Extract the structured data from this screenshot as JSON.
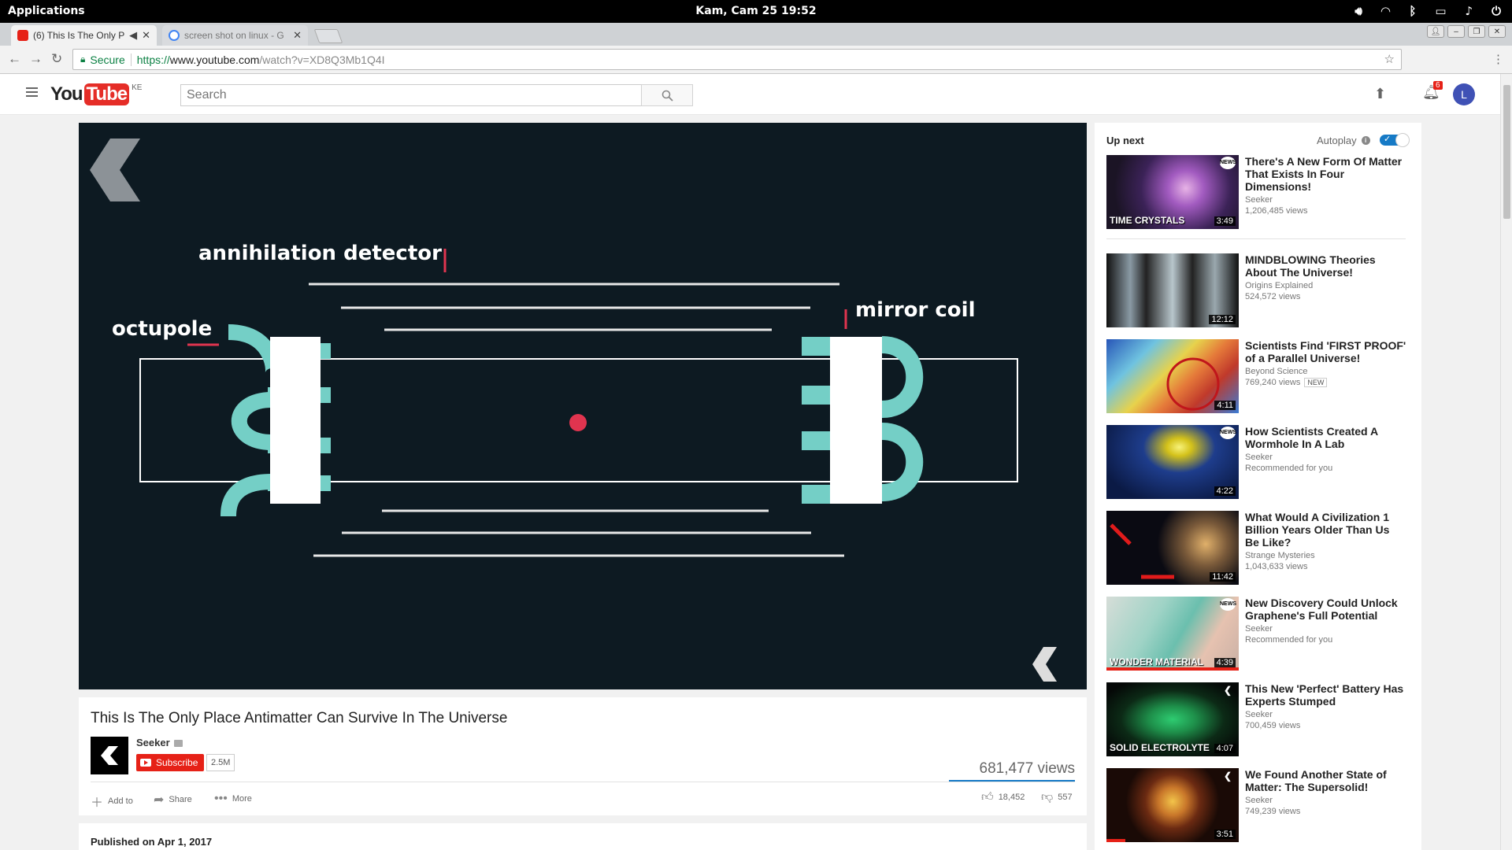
{
  "os_bar": {
    "applications": "Applications",
    "clock": "Kam, Cam 25   19:52"
  },
  "tabs": [
    {
      "label": "(6) This Is The Only P",
      "active": true
    },
    {
      "label": "screen shot on linux - G",
      "active": false
    }
  ],
  "address": {
    "secure": "Secure",
    "proto": "https://",
    "host": "www.youtube.com",
    "path": "/watch?v=XD8Q3Mb1Q4I"
  },
  "header": {
    "logo_you": "You",
    "logo_tube": "Tube",
    "country": "KE",
    "search_placeholder": "Search",
    "notifications": "6",
    "avatar_letter": "L"
  },
  "player": {
    "label_detector": "annihilation detector",
    "label_octupole": "octupole",
    "label_mirror": "mirror coil"
  },
  "video": {
    "title": "This Is The Only Place Antimatter Can Survive In The Universe",
    "channel": "Seeker",
    "subscribe": "Subscribe",
    "subscribers": "2.5M",
    "views": "681,477 views",
    "add_to": "Add to",
    "share": "Share",
    "more": "More",
    "likes": "18,452",
    "dislikes": "557",
    "published": "Published on Apr 1, 2017"
  },
  "sidebar": {
    "up_next": "Up next",
    "autoplay": "Autoplay",
    "items": [
      {
        "title": "There's A New Form Of Matter That Exists In Four Dimensions!",
        "channel": "Seeker",
        "info": "1,206,485 views",
        "duration": "3:49",
        "overlay": "TIME CRYSTALS",
        "badge": ""
      },
      {
        "title": "MINDBLOWING Theories About The Universe!",
        "channel": "Origins Explained",
        "info": "524,572 views",
        "duration": "12:12",
        "overlay": "",
        "badge": ""
      },
      {
        "title": "Scientists Find 'FIRST PROOF' of a Parallel Universe!",
        "channel": "Beyond Science",
        "info": "769,240 views",
        "duration": "4:11",
        "overlay": "",
        "badge": "NEW"
      },
      {
        "title": "How Scientists Created A Wormhole In A Lab",
        "channel": "Seeker",
        "info": "Recommended for you",
        "duration": "4:22",
        "overlay": "",
        "badge": ""
      },
      {
        "title": "What Would A Civilization 1 Billion Years Older Than Us Be Like?",
        "channel": "Strange Mysteries",
        "info": "1,043,633 views",
        "duration": "11:42",
        "overlay": "",
        "badge": ""
      },
      {
        "title": "New Discovery Could Unlock Graphene's Full Potential",
        "channel": "Seeker",
        "info": "Recommended for you",
        "duration": "4:39",
        "overlay": "WONDER MATERIAL",
        "badge": ""
      },
      {
        "title": "This New 'Perfect' Battery Has Experts Stumped",
        "channel": "Seeker",
        "info": "700,459 views",
        "duration": "4:07",
        "overlay": "SOLID ELECTROLYTE",
        "badge": ""
      },
      {
        "title": "We Found Another State of Matter: The Supersolid!",
        "channel": "Seeker",
        "info": "749,239 views",
        "duration": "3:51",
        "overlay": "",
        "badge": ""
      }
    ]
  },
  "colors": {
    "youtube_red": "#e62117",
    "player_bg": "#0d1a22",
    "teal": "#74cfc6",
    "accent_red": "#e0344f"
  }
}
